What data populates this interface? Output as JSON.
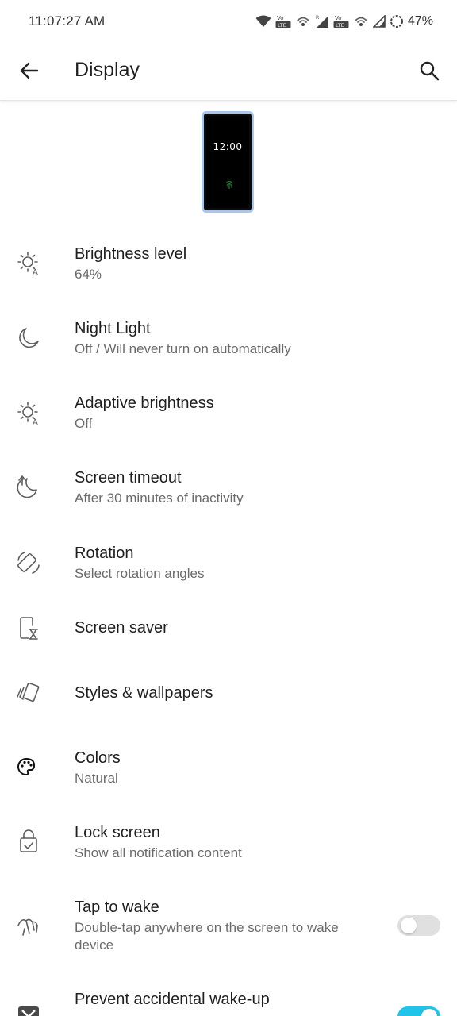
{
  "status_bar": {
    "time": "11:07:27 AM",
    "battery": "47%",
    "icons": [
      "wifi-icon",
      "volte-icon",
      "hotspot-icon",
      "signal-icon",
      "volte-icon",
      "hotspot-icon",
      "signal-icon",
      "battery-saver-icon"
    ]
  },
  "app_bar": {
    "title": "Display",
    "back_icon": "arrow-back-icon",
    "search_icon": "search-icon"
  },
  "preview": {
    "clock": "12:00"
  },
  "settings": [
    {
      "title": "Brightness level",
      "summary": "64%",
      "icon": "brightness-auto-icon"
    },
    {
      "title": "Night Light",
      "summary": "Off / Will never turn on automatically",
      "icon": "moon-icon"
    },
    {
      "title": "Adaptive brightness",
      "summary": "Off",
      "icon": "brightness-auto-icon"
    },
    {
      "title": "Screen timeout",
      "summary": "After 30 minutes of inactivity",
      "icon": "screen-timeout-icon"
    },
    {
      "title": "Rotation",
      "summary": "Select rotation angles",
      "icon": "screen-rotation-icon"
    },
    {
      "title": "Screen saver",
      "summary": "",
      "icon": "screen-saver-icon"
    },
    {
      "title": "Styles & wallpapers",
      "summary": "",
      "icon": "wallpaper-icon"
    },
    {
      "title": "Colors",
      "summary": "Natural",
      "icon": "palette-icon"
    },
    {
      "title": "Lock screen",
      "summary": "Show all notification content",
      "icon": "lock-screen-icon"
    },
    {
      "title": "Tap to wake",
      "summary": "Double-tap anywhere on the screen to wake device",
      "icon": "tap-gesture-icon",
      "toggle": false
    },
    {
      "title": "Prevent accidental wake-up",
      "summary": "",
      "icon": "prevent-wake-icon",
      "toggle": true
    }
  ],
  "colors": {
    "accent": "#21c3e8",
    "toggle_off_track": "#e0e0e0",
    "preview_border": "#a9c6ec"
  }
}
